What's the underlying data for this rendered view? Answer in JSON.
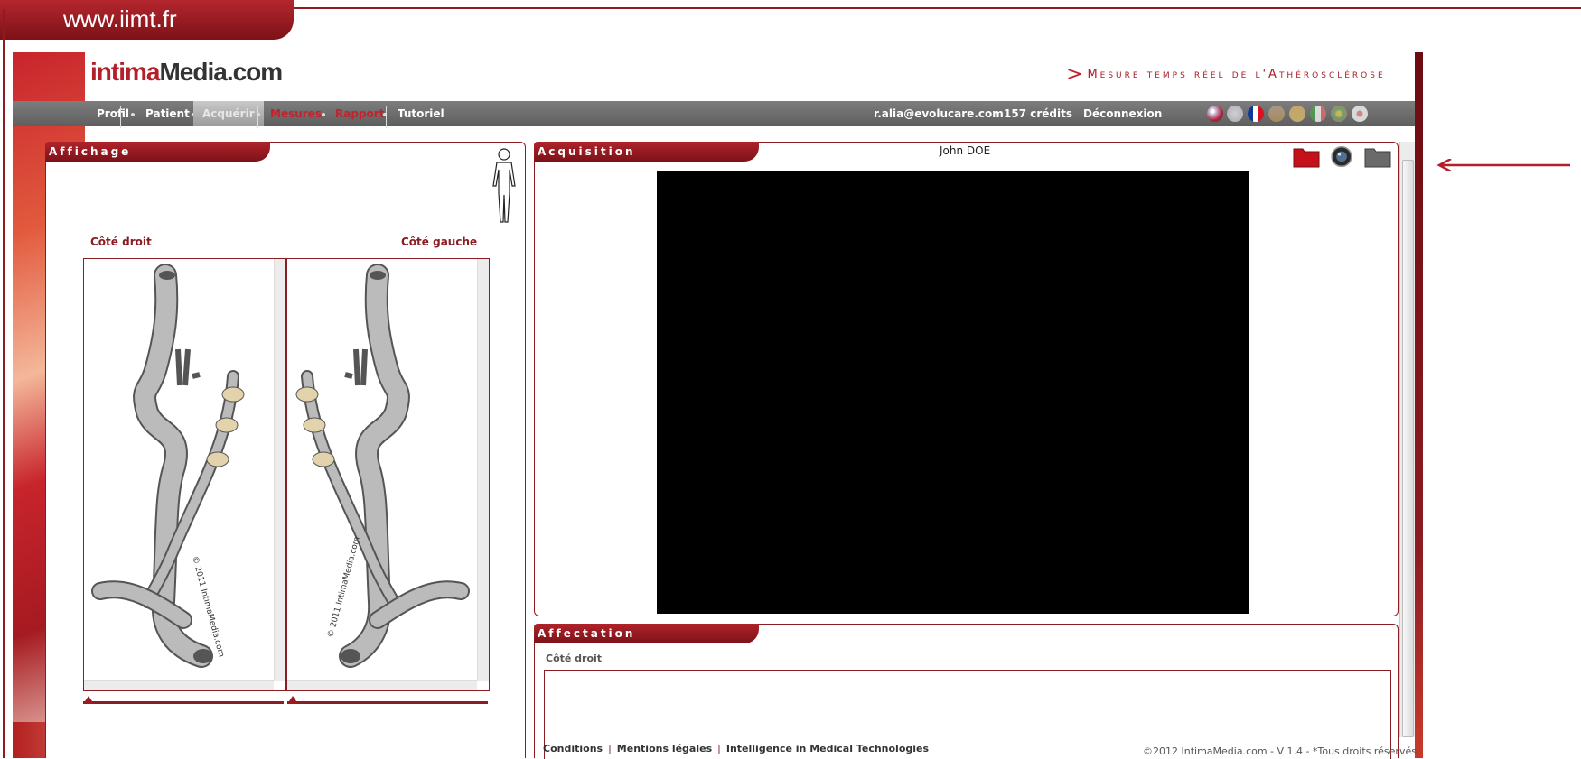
{
  "site": {
    "url_label": "www.iimt.fr"
  },
  "brand": {
    "logo_text_a": "intima",
    "logo_text_b": "Media.com",
    "tagline": "Mesure temps réel de l'Athérosclérose"
  },
  "nav": {
    "items": [
      "Profil",
      "Patient",
      "Acquérir",
      "Mesures",
      "Rapport",
      "Tutoriel"
    ],
    "user_email": "r.alia@evolucare.com",
    "credits": "157 crédits",
    "logout": "Déconnexion"
  },
  "flags": [
    "us-flag-icon",
    "uk-flag-icon",
    "france-flag-icon",
    "germany-flag-icon",
    "spain-flag-icon",
    "italy-flag-icon",
    "portugal-flag-icon",
    "japan-flag-icon"
  ],
  "affichage": {
    "title": "Affichage",
    "right_side": "Côté droit",
    "left_side": "Côté gauche",
    "copyright_right": "© 2011 IntimaMedia.com",
    "copyright_left": "© 2011 IntimaMedia.com"
  },
  "acquisition": {
    "title": "Acquisition",
    "patient_name": "John DOE"
  },
  "affectation": {
    "title": "Affectation",
    "side_label": "Côté droit"
  },
  "footer": {
    "links": [
      "Conditions",
      "Mentions légales",
      "Intelligence in Medical Technologies"
    ],
    "copyright": "©2012 IntimaMedia.com - V 1.4 - *Tous droits réservés"
  },
  "colors": {
    "brand_red": "#8a1c22",
    "nav_gray": "#6b6b6b"
  }
}
